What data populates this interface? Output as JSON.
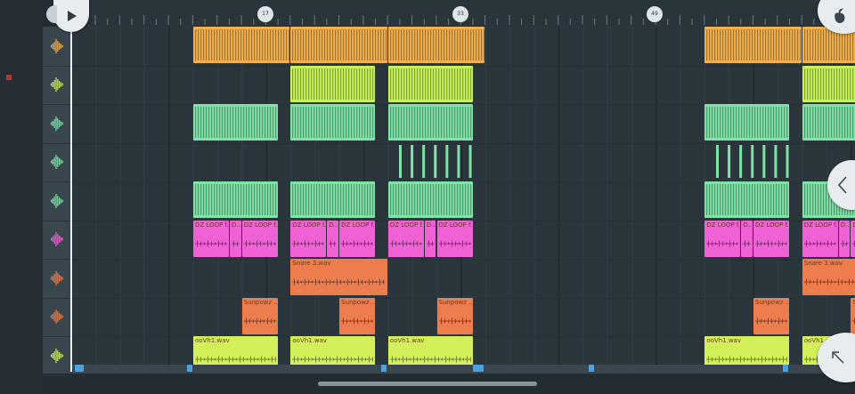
{
  "colors": {
    "background": "#232c33",
    "grid": "#2b353c",
    "header": "#3a464e",
    "orange": "#f2b04e",
    "lime": "#c6f25a",
    "mint": "#7fe3a8",
    "magenta": "#f061d6",
    "salmon": "#ee7d4e",
    "yellowgreen": "#d3f05b"
  },
  "ruler": {
    "markers": [
      "17",
      "33",
      "49"
    ]
  },
  "icons": {
    "play": "play-icon",
    "logo": "fruit-logo-icon",
    "collapse": "chevron-left-icon",
    "expand": "arrow-up-left-icon",
    "track": "waveform-icon"
  },
  "tracks": [
    {
      "color": "#f2b04e",
      "clips": [
        {
          "start": 1,
          "length": 4
        },
        {
          "start": 5,
          "length": 4
        },
        {
          "start": 9,
          "length": 4
        },
        {
          "start": 22,
          "length": 4
        },
        {
          "start": 26,
          "length": 4
        },
        {
          "start": 30,
          "length": 4
        }
      ]
    },
    {
      "color": "#c6f25a",
      "clips": [
        {
          "start": 5,
          "length": 3.5
        },
        {
          "start": 9,
          "length": 3.5
        },
        {
          "start": 26,
          "length": 3.5
        },
        {
          "start": 30,
          "length": 3.5
        }
      ]
    },
    {
      "color": "#7fe3a8",
      "clips": [
        {
          "start": 1,
          "length": 3.5
        },
        {
          "start": 5,
          "length": 3.5
        },
        {
          "start": 9,
          "length": 3.5
        },
        {
          "start": 22,
          "length": 3.5
        },
        {
          "start": 26,
          "length": 3.5
        },
        {
          "start": 30,
          "length": 3.5
        }
      ]
    },
    {
      "color": "#7fe3a8",
      "clips": [
        {
          "start": 9.3,
          "length": 3.2,
          "sparse": true
        },
        {
          "start": 22.3,
          "length": 3.2,
          "sparse": true
        },
        {
          "start": 30.3,
          "length": 3.2,
          "sparse": true
        }
      ]
    },
    {
      "color": "#7fe3a8",
      "clips": [
        {
          "start": 1,
          "length": 3.5
        },
        {
          "start": 5,
          "length": 3.5
        },
        {
          "start": 9,
          "length": 3.5
        },
        {
          "start": 22,
          "length": 3.5
        },
        {
          "start": 26,
          "length": 3.5
        },
        {
          "start": 30,
          "length": 3.5
        }
      ]
    },
    {
      "color": "#f061d6",
      "clips": [
        {
          "start": 1,
          "length": 1.5,
          "label": "DZ LOOP f..."
        },
        {
          "start": 2.5,
          "length": 0.5,
          "label": "D..."
        },
        {
          "start": 3,
          "length": 1.5,
          "label": "DZ LOOP f..."
        },
        {
          "start": 5,
          "length": 1.5,
          "label": "DZ LOOP f..."
        },
        {
          "start": 6.5,
          "length": 0.5,
          "label": "D..."
        },
        {
          "start": 7,
          "length": 1.5,
          "label": "DZ LOOP f..."
        },
        {
          "start": 9,
          "length": 1.5,
          "label": "DZ LOOP f..."
        },
        {
          "start": 10.5,
          "length": 0.5,
          "label": "D..."
        },
        {
          "start": 11,
          "length": 1.5,
          "label": "DZ LOOP f..."
        },
        {
          "start": 22,
          "length": 1.5,
          "label": "DZ LOOP f..."
        },
        {
          "start": 23.5,
          "length": 0.5,
          "label": "D..."
        },
        {
          "start": 24,
          "length": 1.5,
          "label": "DZ LOOP f..."
        },
        {
          "start": 26,
          "length": 1.5,
          "label": "DZ LOOP f..."
        },
        {
          "start": 27.5,
          "length": 0.5,
          "label": "D..."
        },
        {
          "start": 28,
          "length": 1.5,
          "label": "DZ LOOP f..."
        },
        {
          "start": 30,
          "length": 1.5,
          "label": "DZ LOOP f..."
        },
        {
          "start": 31.5,
          "length": 0.5,
          "label": "D..."
        },
        {
          "start": 32,
          "length": 1.5,
          "label": "DZ LOOP f..."
        }
      ]
    },
    {
      "color": "#ee7d4e",
      "clips": [
        {
          "start": 5,
          "length": 4,
          "label": "Snare 3.wav"
        },
        {
          "start": 26,
          "length": 4,
          "label": "Snare 3.wav"
        }
      ]
    },
    {
      "color": "#ee7d4e",
      "clips": [
        {
          "start": 3,
          "length": 1.5,
          "label": "Sunpowz ..."
        },
        {
          "start": 7,
          "length": 1.5,
          "label": "Sunpowz ..."
        },
        {
          "start": 11,
          "length": 1.5,
          "label": "Sunpowz ..."
        },
        {
          "start": 24,
          "length": 1.5,
          "label": "Sunpowz ..."
        },
        {
          "start": 28,
          "length": 1.5,
          "label": "Sunpowz ..."
        },
        {
          "start": 32,
          "length": 1.5,
          "label": "Sunpowz ..."
        }
      ]
    },
    {
      "color": "#d3f05b",
      "clips": [
        {
          "start": 1,
          "length": 3.5,
          "label": "ooVh1.wav"
        },
        {
          "start": 5,
          "length": 3.5,
          "label": "ooVh1.wav"
        },
        {
          "start": 9,
          "length": 3.5,
          "label": "ooVh1.wav"
        },
        {
          "start": 22,
          "length": 3.5,
          "label": "ooVh1.wav"
        },
        {
          "start": 26,
          "length": 3.5,
          "label": "ooVh1.wav"
        },
        {
          "start": 30,
          "length": 3.5,
          "label": "ooVh1.wav"
        }
      ]
    }
  ]
}
